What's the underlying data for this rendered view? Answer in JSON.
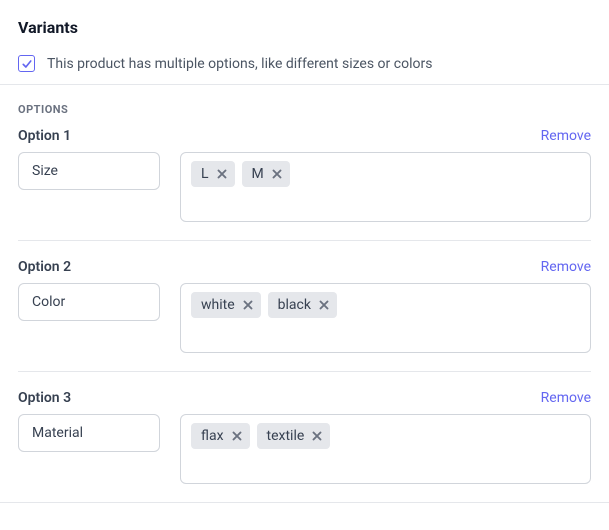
{
  "header": {
    "title": "Variants",
    "checkbox_label": "This product has multiple options, like different sizes or colors"
  },
  "options_heading": "OPTIONS",
  "remove_label": "Remove",
  "options": [
    {
      "label": "Option 1",
      "name": "Size",
      "values": [
        "L",
        "M"
      ]
    },
    {
      "label": "Option 2",
      "name": "Color",
      "values": [
        "white",
        "black"
      ]
    },
    {
      "label": "Option 3",
      "name": "Material",
      "values": [
        "flax",
        "textile"
      ]
    }
  ]
}
